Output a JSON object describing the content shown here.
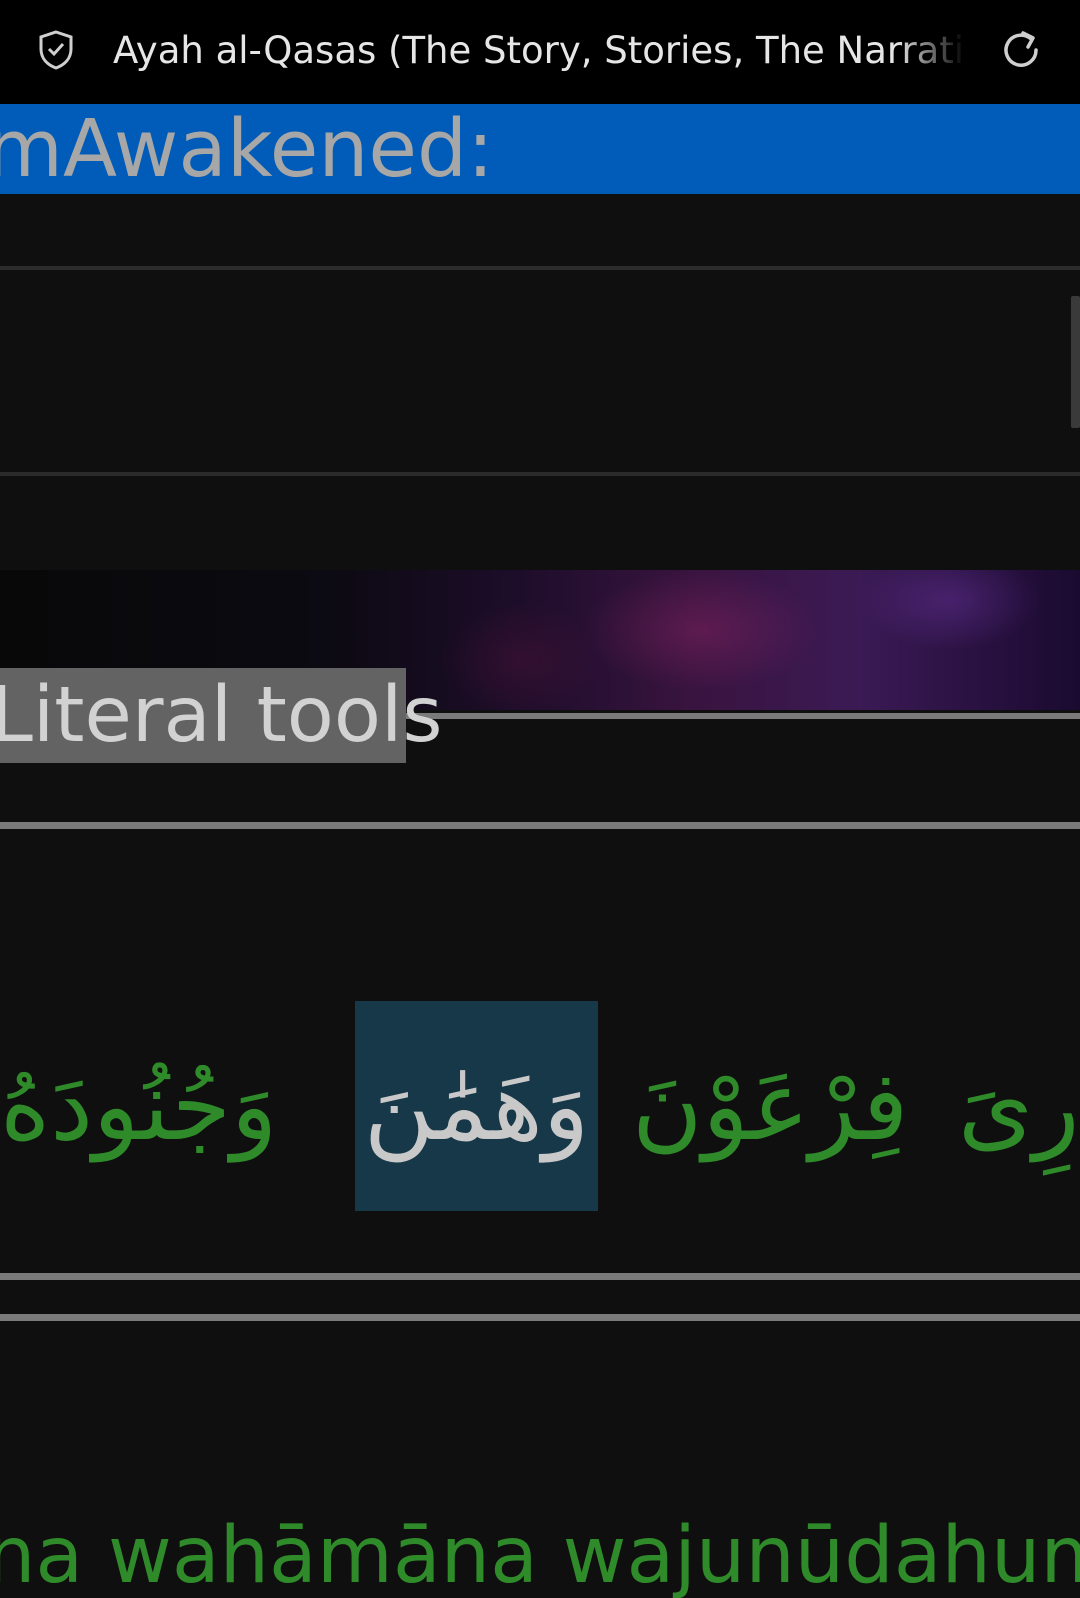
{
  "browser": {
    "title": "Ayah al-Qasas (The Story, Stories, The Narrative)",
    "shield_icon": "shield-check-icon",
    "reload_icon": "reload-icon"
  },
  "site": {
    "banner_text": "mAwakened:",
    "banner_color": "#005cb8"
  },
  "section": {
    "literal_tools_label": "Literal tools"
  },
  "verse": {
    "arabic_words": [
      "رِىَ",
      "فِرْعَوْنَ",
      "وَهَمَٰنَ",
      "وَجُنُودَهُ"
    ],
    "highlighted_word_index": 2,
    "highlight_color": "#173848",
    "text_color": "#2f8a2a",
    "transliteration": "na wahāmāna wajunūdahumā"
  }
}
